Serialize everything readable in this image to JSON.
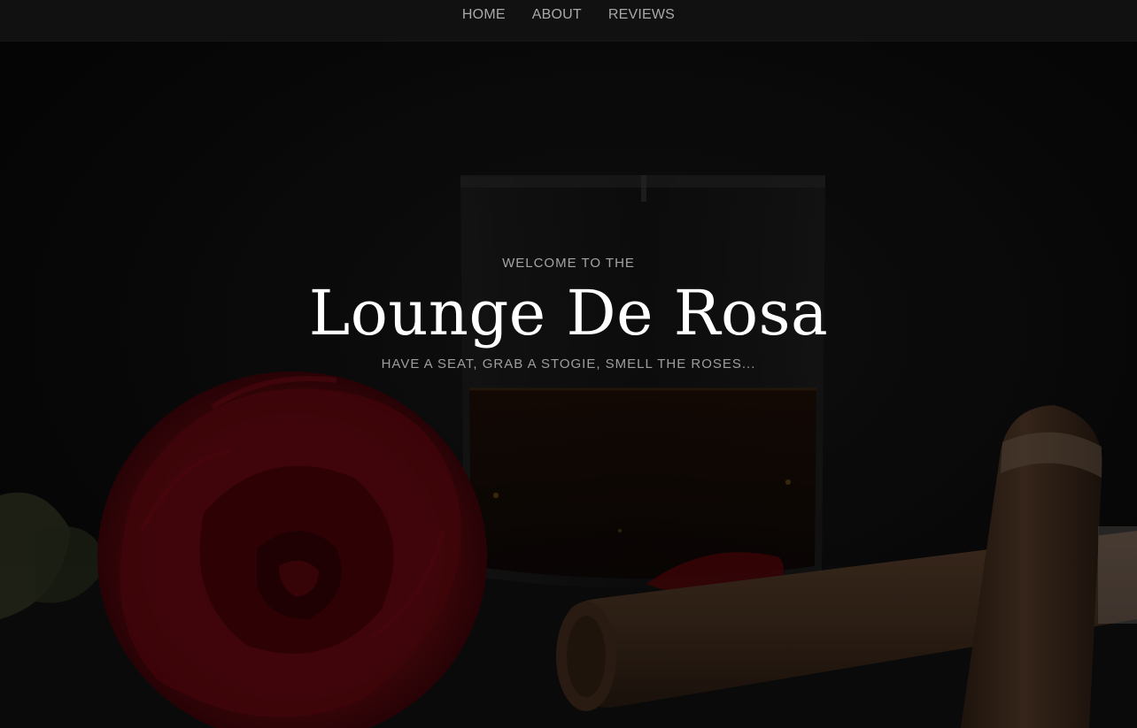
{
  "nav": {
    "items": [
      {
        "label": "HOME"
      },
      {
        "label": "ABOUT"
      },
      {
        "label": "REVIEWS"
      }
    ]
  },
  "hero": {
    "welcome": "WELCOME TO THE",
    "title": "Lounge De Rosa",
    "tagline": "HAVE A SEAT, GRAB A STOGIE, SMELL THE ROSES..."
  },
  "colors": {
    "navbar_bg": "#111111",
    "page_bg": "#0c0c0c",
    "nav_text": "#a9a9a9",
    "title_text": "#ffffff",
    "subtle_text": "#a4a4a4",
    "rose": "#5a0a0f",
    "cigar": "#4a3322"
  },
  "background_image": {
    "icons": [
      "whiskey-glass-icon",
      "rose-icon",
      "cigar-icon"
    ]
  }
}
